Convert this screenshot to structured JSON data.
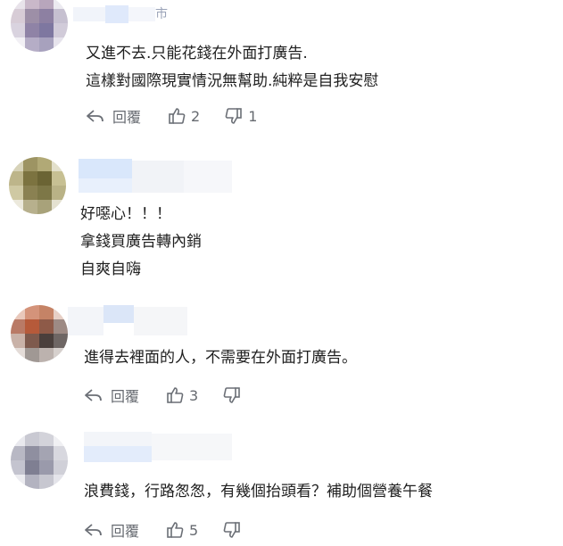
{
  "actions": {
    "reply_label": "回覆"
  },
  "comments": [
    {
      "author_tail": "市",
      "lines": [
        "又進不去.只能花錢在外面打廣告.",
        "這樣對國際現實情況無幫助.純粹是自我安慰"
      ],
      "likes": "2",
      "dislikes": "1",
      "avatar_colors": [
        "#e8e3ea",
        "#c9b8c9",
        "#b8a6bc",
        "#eceaf0",
        "#d7ccd6",
        "#9d8fa7",
        "#8d80a2",
        "#c6c0d0",
        "#d9d3df",
        "#8f83a6",
        "#7e77a0",
        "#d1cbd9",
        "#f2f0f5",
        "#b5adc6",
        "#a7a1bd",
        "#e6e3ec"
      ]
    },
    {
      "lines": [
        "好噁心！！！",
        "拿錢買廣告轉內銷",
        "自爽自嗨"
      ],
      "avatar_colors": [
        "#d7d3b9",
        "#9d9463",
        "#b1a976",
        "#e3e0cb",
        "#bdb58a",
        "#7c7340",
        "#6b6434",
        "#c7c093",
        "#cfc9a3",
        "#8a8152",
        "#7d7747",
        "#b9b286",
        "#ece9dc",
        "#b7b08d",
        "#a8a27a",
        "#e4e1d0"
      ]
    },
    {
      "lines": [
        "進得去裡面的人，不需要在外面打廣告。"
      ],
      "likes": "3",
      "avatar_colors": [
        "#e9c8bb",
        "#d4937a",
        "#c58366",
        "#e7d0c6",
        "#b97a66",
        "#b65a3a",
        "#8e5a48",
        "#9d8a84",
        "#c9b2a8",
        "#7e5a4d",
        "#4a3f3c",
        "#6e6664",
        "#e4dcd8",
        "#a09894",
        "#bcb2ae",
        "#d6d0cd"
      ]
    },
    {
      "lines": [
        "浪費錢，行路怱怱，有幾個抬頭看？補助個營養午餐"
      ],
      "likes": "5",
      "avatar_colors": [
        "#e9e9ee",
        "#c9c9d2",
        "#d3d3da",
        "#f0f0f3",
        "#b8b8c4",
        "#8f8fa0",
        "#a4a4b2",
        "#d8d8df",
        "#c4c4cf",
        "#7f7f92",
        "#9a9aab",
        "#d0d0d8",
        "#ececf0",
        "#b3b3c0",
        "#c7c7d0",
        "#e4e4ea"
      ]
    }
  ]
}
